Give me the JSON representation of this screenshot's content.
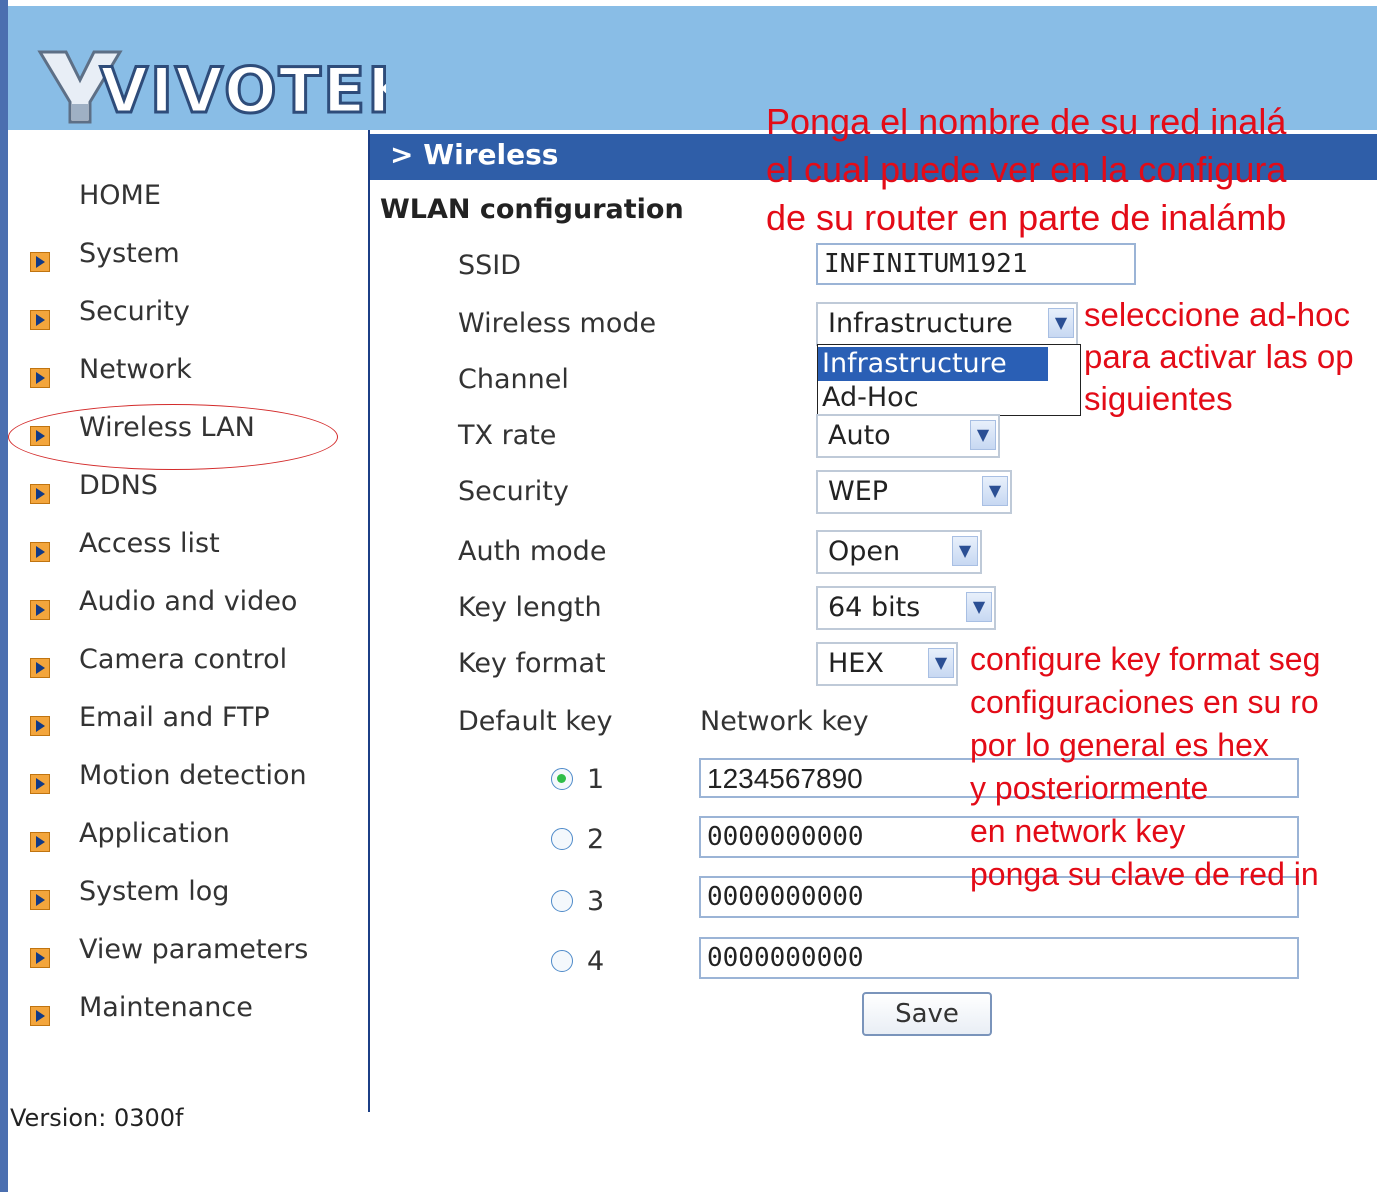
{
  "logo_text": "VIVOTEK",
  "sidebar": {
    "home": "HOME",
    "items": [
      {
        "label": "System"
      },
      {
        "label": "Security"
      },
      {
        "label": "Network"
      },
      {
        "label": "Wireless LAN"
      },
      {
        "label": "DDNS"
      },
      {
        "label": "Access list"
      },
      {
        "label": "Audio and video"
      },
      {
        "label": "Camera control"
      },
      {
        "label": "Email and FTP"
      },
      {
        "label": "Motion detection"
      },
      {
        "label": "Application"
      },
      {
        "label": "System log"
      },
      {
        "label": "View parameters"
      },
      {
        "label": "Maintenance"
      }
    ],
    "version": "Version: 0300f"
  },
  "main": {
    "page_title": "> Wireless",
    "section": "WLAN configuration",
    "labels": {
      "ssid": "SSID",
      "wireless_mode": "Wireless mode",
      "channel": "Channel",
      "tx_rate": "TX rate",
      "security": "Security",
      "auth_mode": "Auth mode",
      "key_length": "Key length",
      "key_format": "Key format",
      "default_key": "Default key",
      "network_key": "Network key"
    },
    "values": {
      "ssid": "INFINITUM1921",
      "wireless_mode": "Infrastructure",
      "tx_rate": "Auto",
      "security": "WEP",
      "auth_mode": "Open",
      "key_length": "64 bits",
      "key_format": "HEX"
    },
    "wireless_mode_options": [
      "Infrastructure",
      "Ad-Hoc"
    ],
    "keys": [
      {
        "num": "1",
        "value": "1234567890",
        "selected": true
      },
      {
        "num": "2",
        "value": "0000000000",
        "selected": false
      },
      {
        "num": "3",
        "value": "0000000000",
        "selected": false
      },
      {
        "num": "4",
        "value": "0000000000",
        "selected": false
      }
    ],
    "save_label": "Save"
  },
  "annotations": {
    "top": [
      "Ponga el nombre de su red inalá",
      "el cual puede ver en la configura",
      "de su router en parte de inalámb"
    ],
    "mode": [
      "seleccione ad-hoc",
      "para activar las op",
      "siguientes"
    ],
    "key": [
      "configure key format seg",
      "configuraciones en su ro",
      "por lo general es hex",
      "y posteriormente",
      "en network key",
      "ponga su clave de red in"
    ]
  },
  "colors": {
    "header": "#89bde6",
    "title_bar": "#2f5ea8",
    "annotation": "#e30b17"
  }
}
